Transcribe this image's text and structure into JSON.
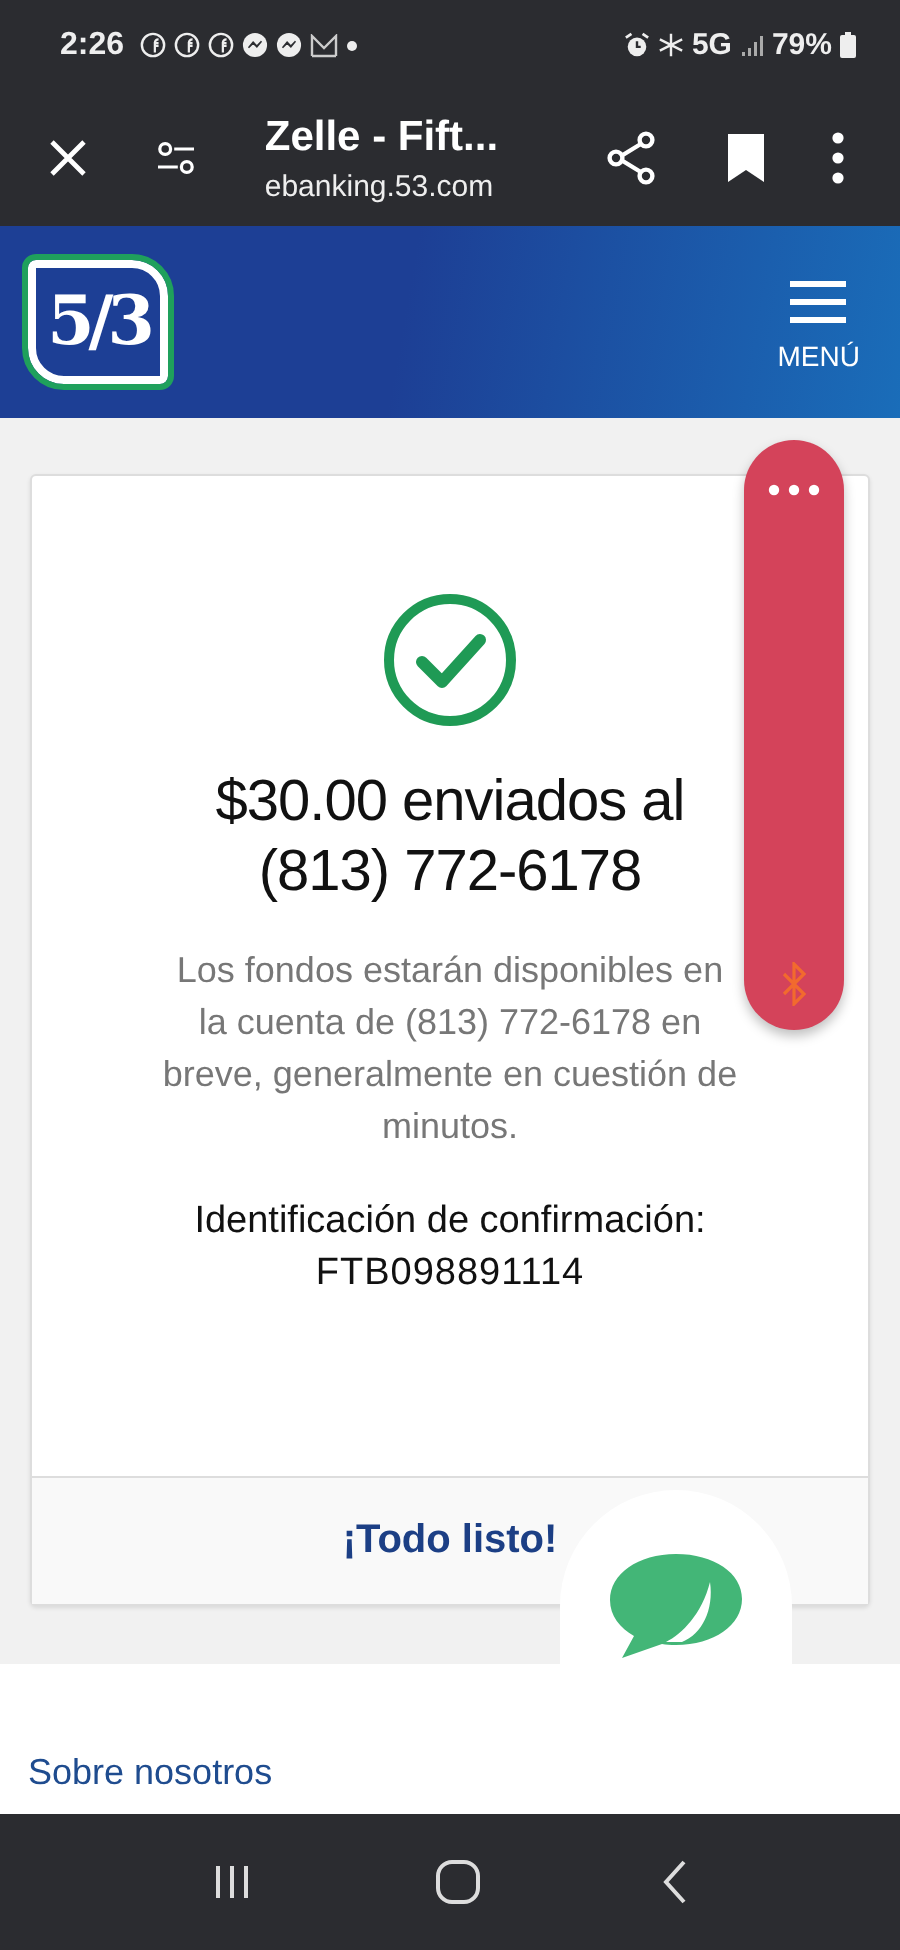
{
  "status_bar": {
    "time": "2:26",
    "battery": "79%",
    "network": "5G"
  },
  "browser_bar": {
    "title": "Zelle - Fift...",
    "url": "ebanking.53.com"
  },
  "header": {
    "logo_text": "5/3",
    "menu_label": "MENÚ"
  },
  "confirmation": {
    "headline": "$30.00 enviados al (813) 772-6178",
    "message": "Los fondos estarán disponibles en la cuenta de (813) 772-6178 en breve, generalmente en cuestión de minutos.",
    "id_label": "Identificación de confirmación:",
    "id_value": "FTB098891114",
    "action": "¡Todo listo!"
  },
  "footer": {
    "links": [
      "Sobre nosotros"
    ]
  }
}
